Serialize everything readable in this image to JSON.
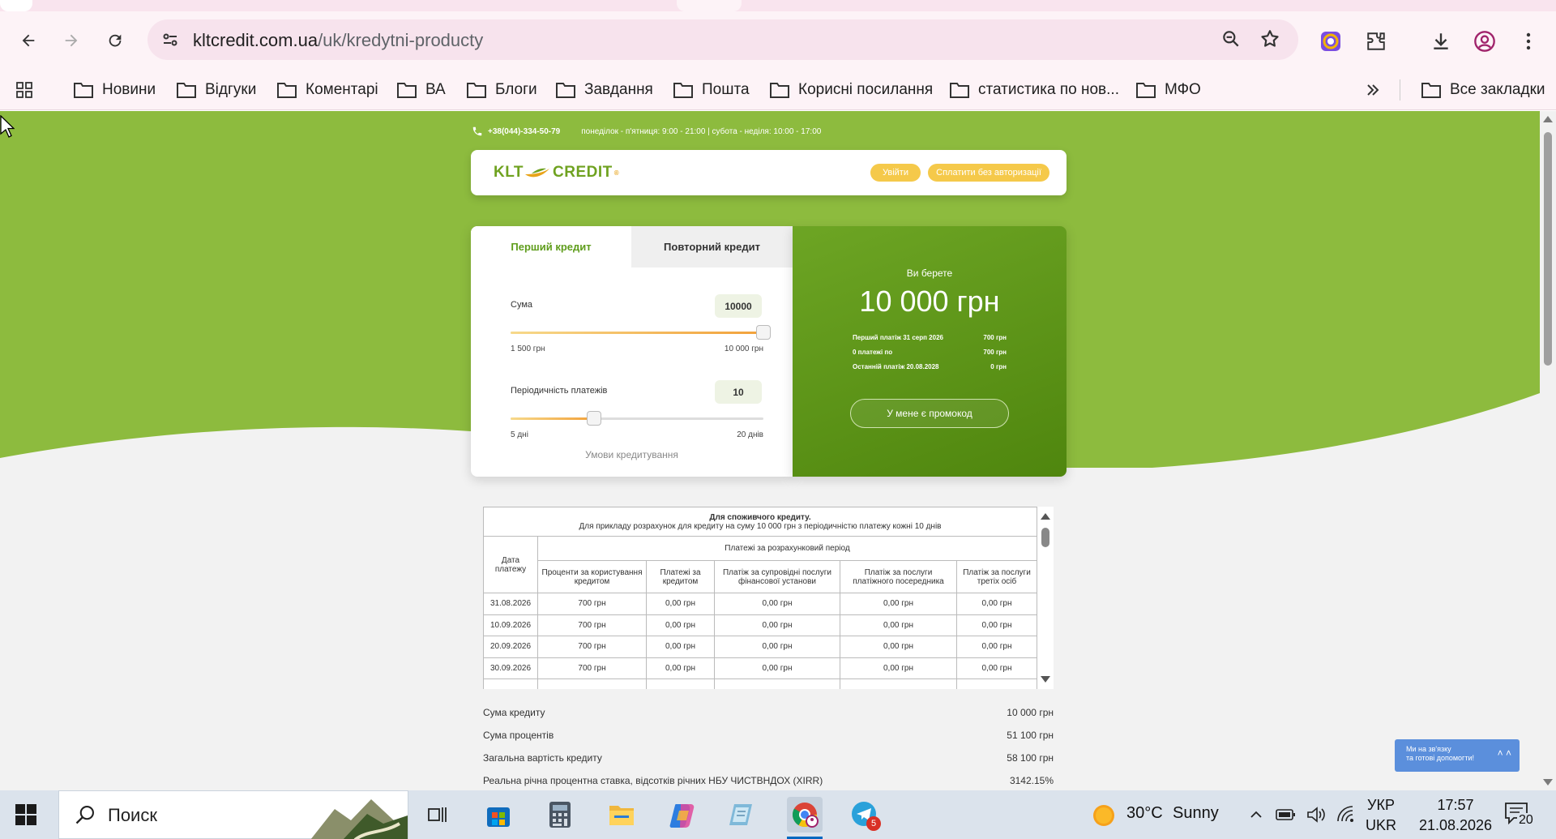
{
  "browser": {
    "url_host": "kltcredit.com.ua",
    "url_path": "/uk/kredytni-producty",
    "bookmarks": [
      "Новини",
      "Відгуки",
      "Коментарі",
      "ВА",
      "Блоги",
      "Завдання",
      "Пошта",
      "Корисні посилання",
      "статистика по нов...",
      "МФО"
    ],
    "all_bookmarks": "Все закладки"
  },
  "page": {
    "phone": "+38(044)-334-50-79",
    "hours": "понеділок - п'ятниця: 9:00 - 21:00 | субота - неділя: 10:00 - 17:00",
    "logo_left": "KLT",
    "logo_right": "CREDIT",
    "logo_mark": "®",
    "login_btn": "Увійти",
    "pay_btn": "Сплатити без авторизації",
    "calculator": {
      "tab_first": "Перший кредит",
      "tab_repeat": "Повторний кредит",
      "sum_label": "Сума",
      "sum_value": "10000",
      "sum_min": "1 500 грн",
      "sum_max": "10 000 грн",
      "sum_fraction": 1.0,
      "period_label": "Періодичність платежів",
      "period_value": "10",
      "period_min": "5 дні",
      "period_max": "20 днів",
      "period_fraction": 0.33,
      "terms": "Умови кредитування"
    },
    "result": {
      "title": "Ви берете",
      "amount": "10 000 грн",
      "rows": [
        {
          "label": "Перший платіж  31 серп 2026",
          "value": "700 грн"
        },
        {
          "label": "0 платежі по",
          "value": "700 грн"
        },
        {
          "label": "Останній платіж 20.08.2028",
          "value": "0 грн"
        }
      ],
      "promo": "У мене є промокод"
    },
    "table": {
      "caption_bold": "Для споживчого кредиту.",
      "caption": "Для прикладу розрахунок для кредиту на суму 10 000 грн з періодичністю платежу кожні 10 днів",
      "col_date": "Дата платежу",
      "group_header": "Платежі за розрахунковий період",
      "cols": [
        "Проценти за користування кредитом",
        "Платежі за кредитом",
        "Платіж за супровідні послуги фінансової установи",
        "Платіж за послуги платіжного посередника",
        "Платіж за послуги третіх осіб"
      ],
      "rows": [
        [
          "31.08.2026",
          "700 грн",
          "0,00 грн",
          "0,00 грн",
          "0,00 грн",
          "0,00 грн"
        ],
        [
          "10.09.2026",
          "700 грн",
          "0,00 грн",
          "0,00 грн",
          "0,00 грн",
          "0,00 грн"
        ],
        [
          "20.09.2026",
          "700 грн",
          "0,00 грн",
          "0,00 грн",
          "0,00 грн",
          "0,00 грн"
        ],
        [
          "30.09.2026",
          "700 грн",
          "0,00 грн",
          "0,00 грн",
          "0,00 грн",
          "0,00 грн"
        ]
      ]
    },
    "summary": [
      {
        "label": "Сума кредиту",
        "value": "10 000 грн"
      },
      {
        "label": "Сума процентів",
        "value": "51 100 грн"
      },
      {
        "label": "Загальна вартість кредиту",
        "value": "58 100 грн"
      },
      {
        "label": "Реальна річна процентна ставка, відсотків річних НБУ ЧИСТВНДОХ (XIRR)",
        "value": "3142.15%"
      }
    ],
    "chat": {
      "line1": "Ми на зв'язку",
      "line2": "та готові допомогти!"
    }
  },
  "taskbar": {
    "search_label": "Поиск",
    "weather_temp": "30°C",
    "weather_text": "Sunny",
    "lang_top": "УКР",
    "lang_bottom": "UKR",
    "time": "17:57",
    "date": "21.08.2026",
    "telegram_badge": "5",
    "notification_count": "20"
  },
  "colors": {
    "brand_green": "#8dbb3e",
    "brand_dark_green": "#4f860e",
    "accent_yellow": "#f5c94a",
    "chat_blue": "#5b8fdc"
  }
}
